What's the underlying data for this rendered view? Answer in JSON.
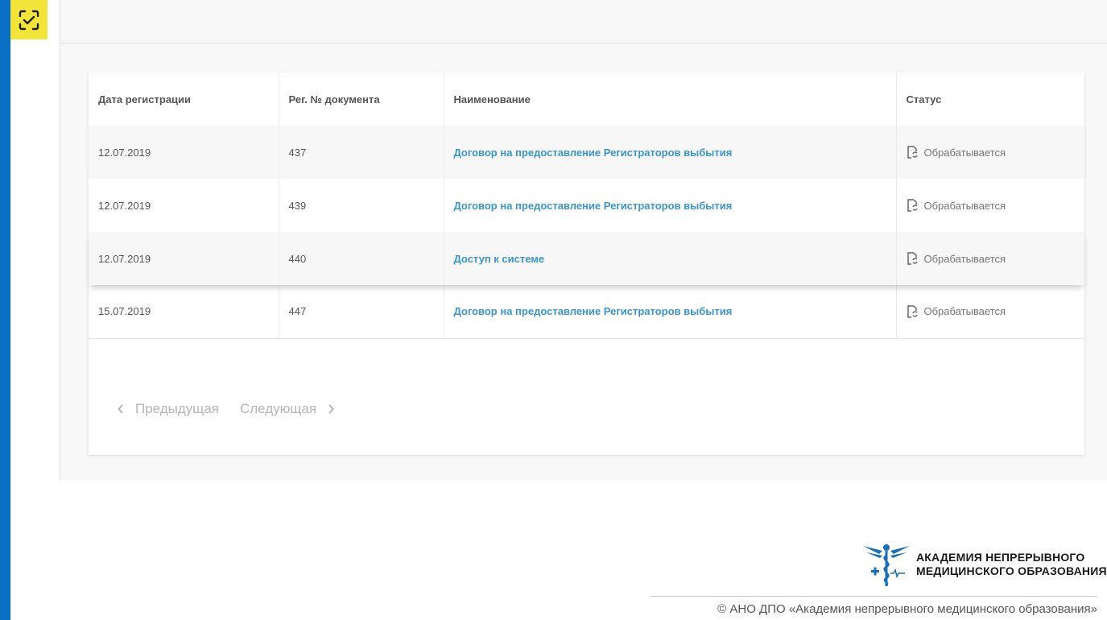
{
  "table": {
    "headers": [
      "Дата регистрации",
      "Рег. № документа",
      "Наименование",
      "Статус"
    ],
    "rows": [
      {
        "date": "12.07.2019",
        "number": "437",
        "name": "Договор на предоставление Регистраторов выбытия",
        "status": "Обрабатывается"
      },
      {
        "date": "12.07.2019",
        "number": "439",
        "name": "Договор на предоставление Регистраторов выбытия",
        "status": "Обрабатывается"
      },
      {
        "date": "12.07.2019",
        "number": "440",
        "name": "Доступ к системе",
        "status": "Обрабатывается"
      },
      {
        "date": "15.07.2019",
        "number": "447",
        "name": "Договор на предоставление Регистраторов выбытия",
        "status": "Обрабатывается"
      }
    ]
  },
  "pager": {
    "prev_label": "Предыдущая",
    "next_label": "Следующая"
  },
  "footer": {
    "logo_line1": "АКАДЕМИЯ НЕПРЕРЫВНОГО",
    "logo_line2": "МЕДИЦИНСКОГО ОБРАЗОВАНИЯ",
    "copyright": "© АНО ДПО «Академия непрерывного медицинского образования»"
  },
  "icons": {
    "scan": "scan-icon",
    "status": "document-sync-icon",
    "prev": "chevron-left-icon",
    "next": "chevron-right-icon",
    "logo": "caduceus-logo-icon"
  },
  "colors": {
    "accent_blue": "#0a6ec5",
    "scan_yellow": "#f3e43c",
    "link_blue": "#3c95c8"
  }
}
